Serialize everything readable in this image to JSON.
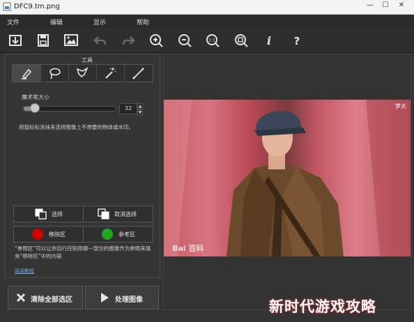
{
  "window": {
    "title": "DFC9.tm.png",
    "controls": [
      "—",
      "☐",
      "✕"
    ]
  },
  "menu": {
    "items": [
      "文件",
      "编辑",
      "显示",
      "帮助"
    ]
  },
  "toolbar": {
    "buttons": [
      "save-to-folder",
      "save",
      "open-image",
      "undo",
      "redo",
      "zoom-in",
      "zoom-out",
      "actual-size",
      "fit-to-window",
      "info",
      "help"
    ]
  },
  "tools_panel": {
    "title": "工具",
    "tools": [
      "brush",
      "lasso",
      "polygon-lasso",
      "magic-wand",
      "line"
    ],
    "brush_size_label": "魔术笔大小",
    "brush_size_value": "32",
    "brush_size_fraction": 0.12,
    "hint": "用鼠标标涂抹来选择图像上不想要的物体或水印。",
    "select_label": "选择",
    "deselect_label": "取消选择",
    "remove_region_label": "移除区",
    "reference_region_label": "参考区",
    "remove_color": "#d40000",
    "reference_color": "#1fa81f",
    "note": "“参照区”可以让你自行控制用哪一部分的图像作为参照来填充“移除区”中的内容",
    "link": "阅读教程"
  },
  "actions": {
    "clear_all_label": "清除全部选区",
    "process_label": "处理图像"
  },
  "canvas": {
    "watermark": "Bai 百科",
    "seal": "梦大"
  },
  "overlay": {
    "text": "新时代游戏攻略"
  }
}
